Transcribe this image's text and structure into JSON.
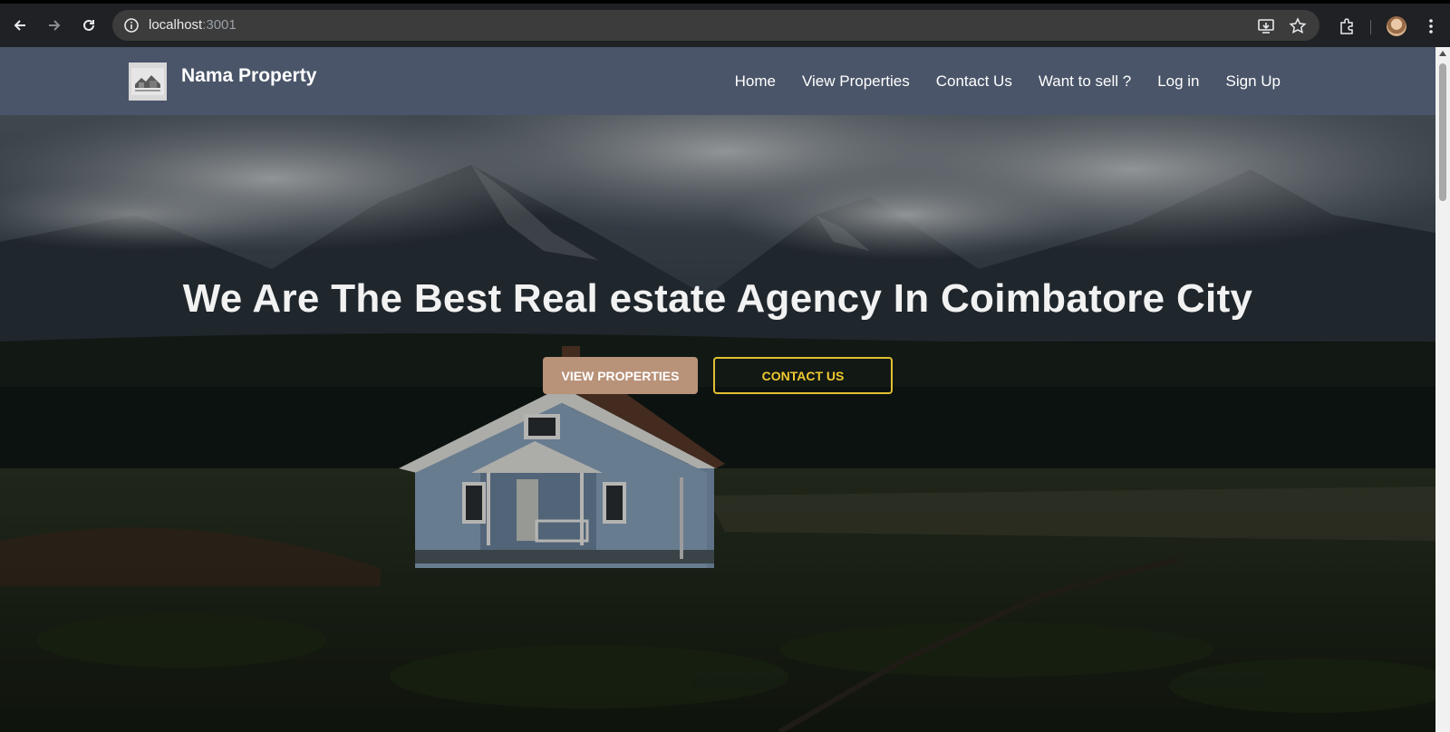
{
  "browser": {
    "url_host": "localhost",
    "url_port": ":3001",
    "icons": [
      "back-icon",
      "forward-icon",
      "reload-icon",
      "site-info-icon",
      "install-app-icon",
      "bookmark-star-icon",
      "extensions-icon",
      "profile-avatar",
      "kebab-menu-icon"
    ]
  },
  "site": {
    "brand": "Nama Property",
    "nav": {
      "home": "Home",
      "view_properties": "View Properties",
      "contact_us": "Contact Us",
      "want_to_sell": "Want to sell ?",
      "log_in": "Log in",
      "sign_up": "Sign Up"
    },
    "hero": {
      "title": "We Are The Best Real estate Agency In Coimbatore City",
      "primary_button": "VIEW PROPERTIES",
      "secondary_button": "CONTACT US"
    }
  },
  "colors": {
    "navbar": "#4a5569",
    "primary_button": "#b89279",
    "outline_button": "#e0c033"
  }
}
